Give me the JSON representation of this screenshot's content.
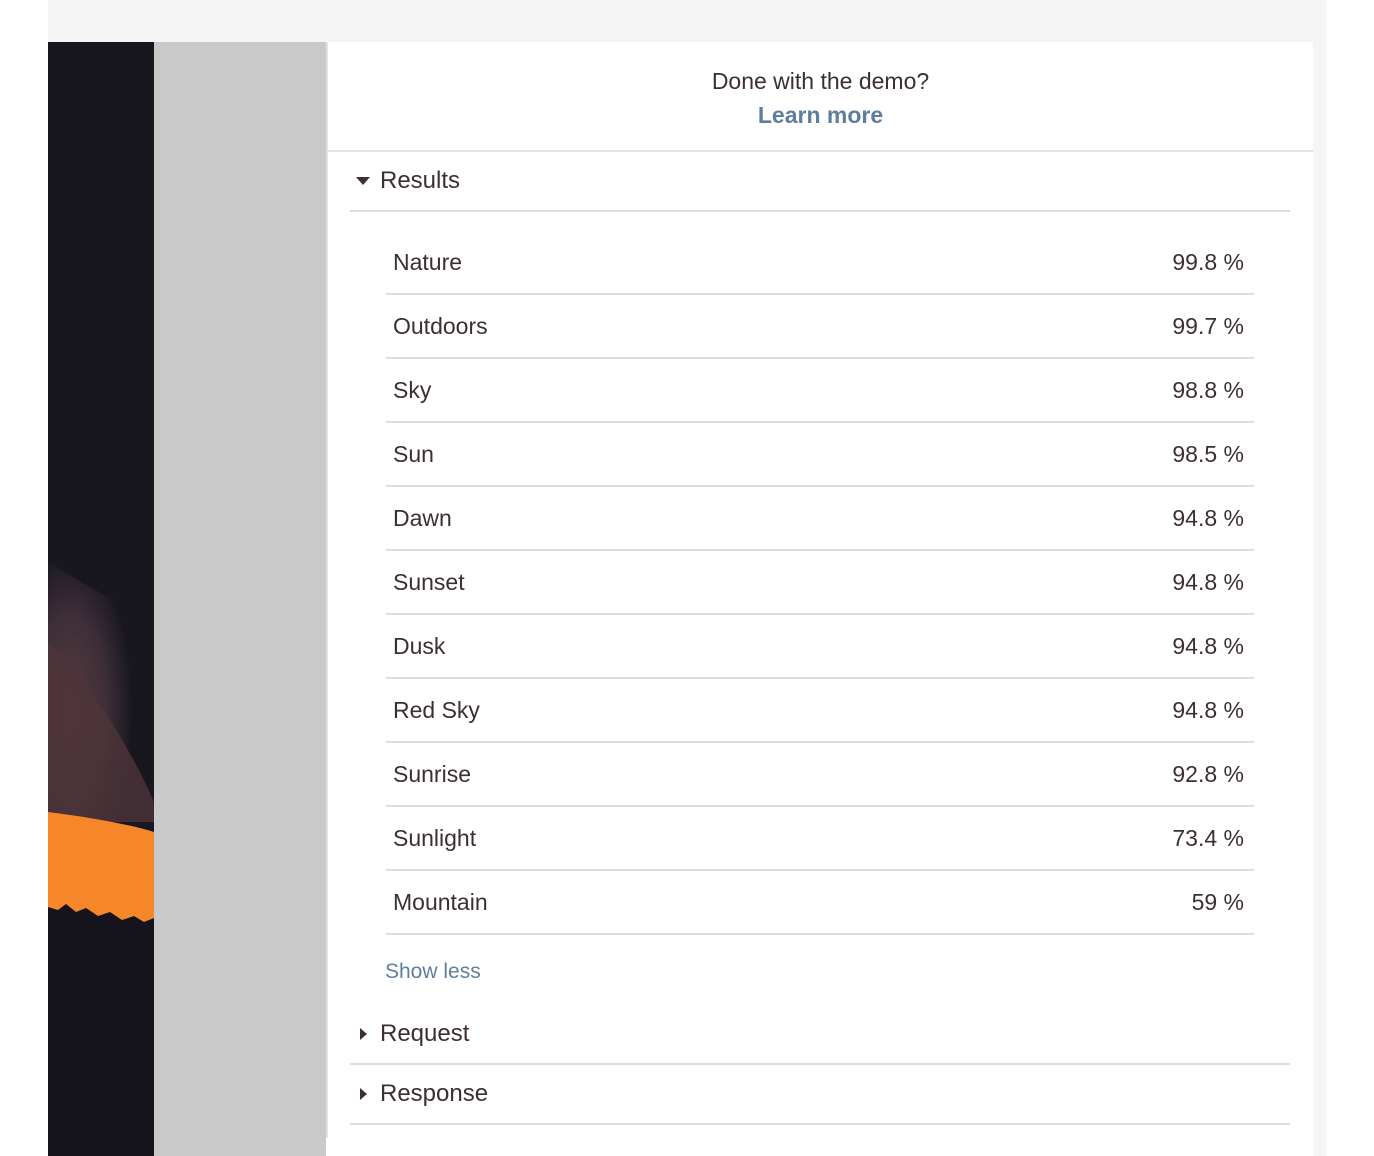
{
  "demo": {
    "title": "Done with the demo?",
    "link": "Learn more"
  },
  "sections": {
    "results": {
      "label": "Results",
      "expanded": true
    },
    "request": {
      "label": "Request",
      "expanded": false
    },
    "response": {
      "label": "Response",
      "expanded": false
    }
  },
  "results": [
    {
      "label": "Nature",
      "confidence": "99.8 %"
    },
    {
      "label": "Outdoors",
      "confidence": "99.7 %"
    },
    {
      "label": "Sky",
      "confidence": "98.8 %"
    },
    {
      "label": "Sun",
      "confidence": "98.5 %"
    },
    {
      "label": "Dawn",
      "confidence": "94.8 %"
    },
    {
      "label": "Sunset",
      "confidence": "94.8 %"
    },
    {
      "label": "Dusk",
      "confidence": "94.8 %"
    },
    {
      "label": "Red Sky",
      "confidence": "94.8 %"
    },
    {
      "label": "Sunrise",
      "confidence": "92.8 %"
    },
    {
      "label": "Sunlight",
      "confidence": "73.4 %"
    },
    {
      "label": "Mountain",
      "confidence": "59 %"
    }
  ],
  "show_less": "Show less",
  "colors": {
    "link": "#5f7e9b",
    "text": "#3b2f35",
    "divider": "#dddddd",
    "sunset_orange": "#f5862a",
    "photo_dark": "#181720"
  },
  "icons": {
    "expanded": "caret-down-icon",
    "collapsed": "caret-right-icon"
  }
}
